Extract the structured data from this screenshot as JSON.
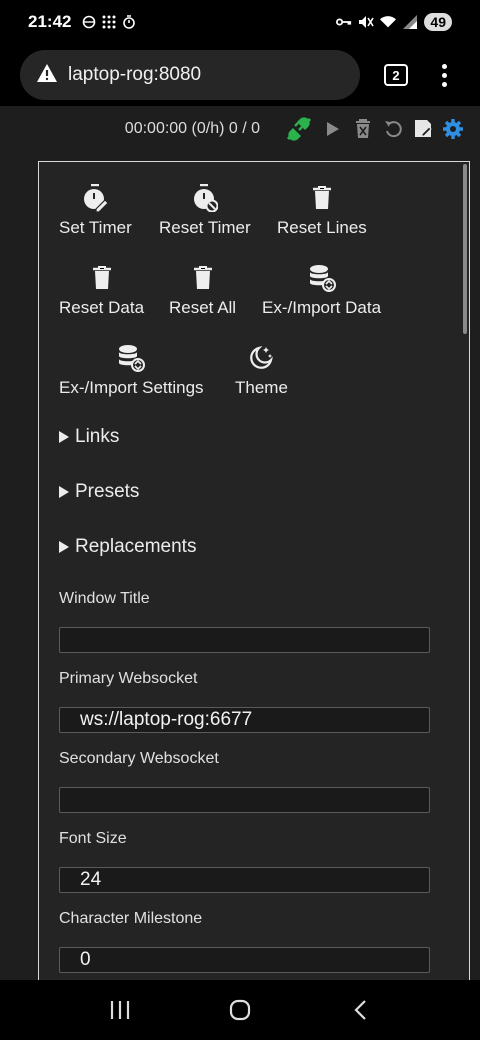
{
  "status_bar": {
    "time": "21:42",
    "battery": "49"
  },
  "browser": {
    "url": "laptop-rog:8080",
    "tab_count": "2"
  },
  "toolbar": {
    "timer_readout": "00:00:00 (0/h) 0 / 0",
    "accent_green": "#2bb24c",
    "accent_blue": "#2f8fe0"
  },
  "actions": [
    {
      "label": "Set Timer",
      "icon": "timer-edit-icon"
    },
    {
      "label": "Reset Timer",
      "icon": "timer-reset-icon"
    },
    {
      "label": "Reset Lines",
      "icon": "trash-icon"
    },
    {
      "label": "Reset Data",
      "icon": "trash-icon"
    },
    {
      "label": "Reset All",
      "icon": "trash-icon"
    },
    {
      "label": "Ex-/Import Data",
      "icon": "database-sync-icon"
    },
    {
      "label": "Ex-/Import Settings",
      "icon": "database-sync-icon"
    },
    {
      "label": "Theme",
      "icon": "moon-stars-icon"
    }
  ],
  "sections": {
    "links": "Links",
    "presets": "Presets",
    "replacements": "Replacements"
  },
  "fields": {
    "window_title": {
      "label": "Window Title",
      "value": ""
    },
    "primary_ws": {
      "label": "Primary Websocket",
      "value": "ws://laptop-rog:6677"
    },
    "secondary_ws": {
      "label": "Secondary Websocket",
      "value": ""
    },
    "font_size": {
      "label": "Font Size",
      "value": "24"
    },
    "char_milestone": {
      "label": "Character Milestone",
      "value": "0"
    }
  }
}
